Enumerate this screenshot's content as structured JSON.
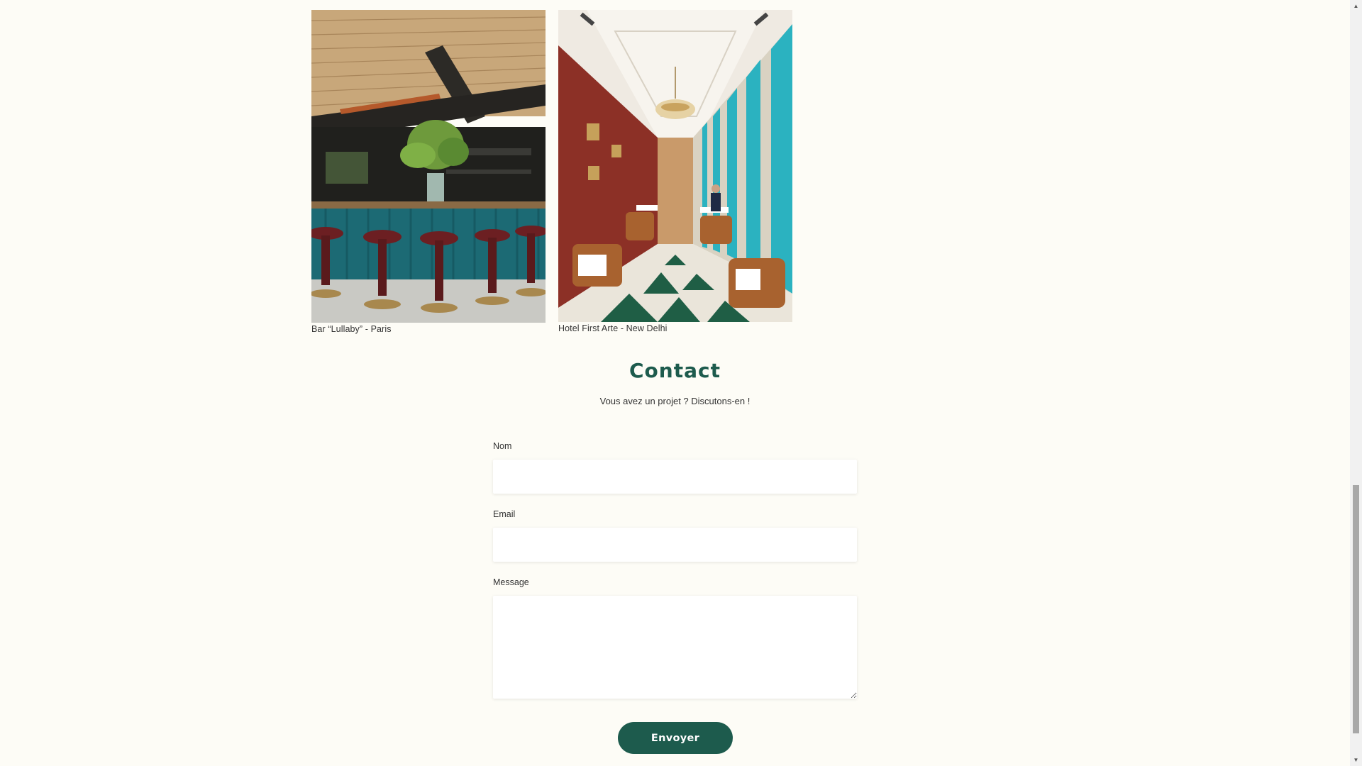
{
  "gallery": {
    "items": [
      {
        "caption": "Bar “Lullaby” - Paris",
        "image": "bar-interior-photo"
      },
      {
        "caption": "Hotel First Arte - New Delhi",
        "image": "hotel-lounge-photo"
      }
    ]
  },
  "contact": {
    "title": "Contact",
    "subtitle": "Vous avez un projet ? Discutons-en !",
    "fields": {
      "name_label": "Nom",
      "name_value": "",
      "email_label": "Email",
      "email_value": "",
      "message_label": "Message",
      "message_value": ""
    },
    "submit_label": "Envoyer"
  },
  "colors": {
    "page_bg": "#fdfcf6",
    "accent": "#1d5b4d",
    "input_bg": "#ffffff"
  },
  "scrollbar": {
    "up_icon": "triangle-up-icon",
    "down_icon": "triangle-down-icon"
  }
}
